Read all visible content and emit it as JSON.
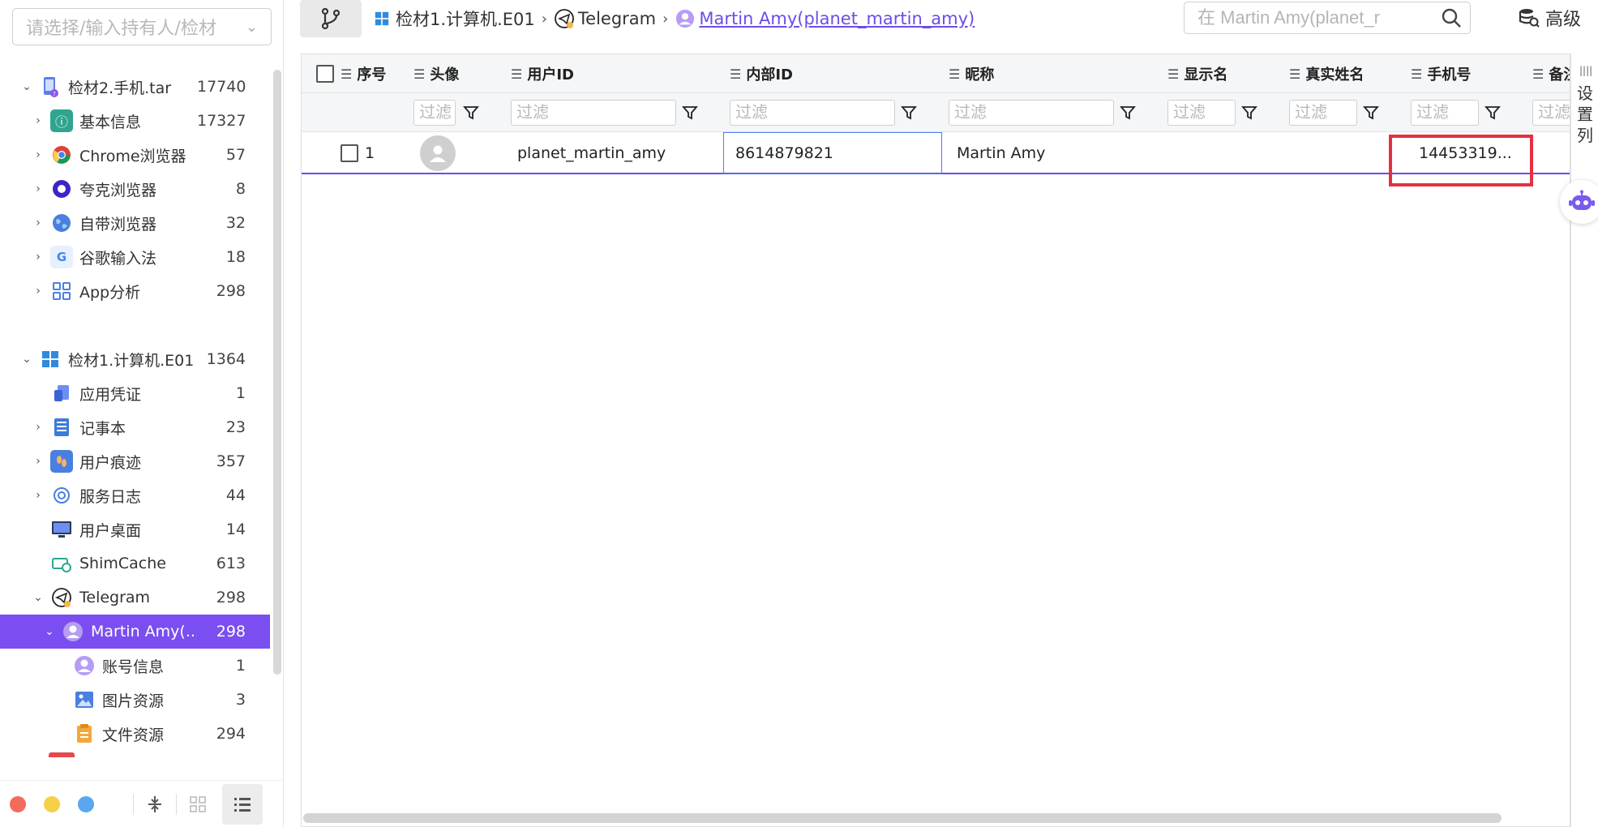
{
  "sidebar": {
    "holder_placeholder": "请选择/输入持有人/检材",
    "tree": [
      {
        "label": "检材2.手机.tar",
        "count": "17740",
        "icon": "phone-evidence-icon",
        "level": 0,
        "expanded": true
      },
      {
        "label": "基本信息",
        "count": "17327",
        "icon": "info-icon",
        "level": 1
      },
      {
        "label": "Chrome浏览器",
        "count": "57",
        "icon": "chrome-icon",
        "level": 1
      },
      {
        "label": "夸克浏览器",
        "count": "8",
        "icon": "quark-icon",
        "level": 1
      },
      {
        "label": "自带浏览器",
        "count": "32",
        "icon": "globe-icon",
        "level": 1
      },
      {
        "label": "谷歌输入法",
        "count": "18",
        "icon": "google-ime-icon",
        "level": 1
      },
      {
        "label": "App分析",
        "count": "298",
        "icon": "apps-grid-icon",
        "level": 1
      },
      {
        "label": "检材1.计算机.E01",
        "count": "1364",
        "icon": "windows-icon",
        "level": 0,
        "expanded": true
      },
      {
        "label": "应用凭证",
        "count": "1",
        "icon": "credential-icon",
        "level": 1
      },
      {
        "label": "记事本",
        "count": "23",
        "icon": "notepad-icon",
        "level": 1
      },
      {
        "label": "用户痕迹",
        "count": "357",
        "icon": "footprint-icon",
        "level": 1
      },
      {
        "label": "服务日志",
        "count": "44",
        "icon": "service-log-icon",
        "level": 1
      },
      {
        "label": "用户桌面",
        "count": "14",
        "icon": "desktop-icon",
        "level": 1
      },
      {
        "label": "ShimCache",
        "count": "613",
        "icon": "shimcache-icon",
        "level": 1
      },
      {
        "label": "Telegram",
        "count": "298",
        "icon": "telegram-icon",
        "level": 1,
        "expanded": true
      },
      {
        "label": "Martin Amy(...",
        "count": "298",
        "icon": "user-icon",
        "level": 2,
        "expanded": true,
        "active": true
      },
      {
        "label": "账号信息",
        "count": "1",
        "icon": "account-icon",
        "level": 3
      },
      {
        "label": "图片资源",
        "count": "3",
        "icon": "image-icon",
        "level": 3
      },
      {
        "label": "文件资源",
        "count": "294",
        "icon": "file-icon",
        "level": 3
      }
    ],
    "footer": {
      "dots": [
        "#f26b5b",
        "#f7d04a",
        "#5aa6f0"
      ]
    }
  },
  "topbar": {
    "crumbs": [
      "检材1.计算机.E01",
      "Telegram",
      "Martin Amy(planet_martin_amy)"
    ],
    "search_placeholder": "在 Martin Amy(planet_martin_amy) 中搜索",
    "search_value": "在 Martin Amy(planet_r",
    "advanced_label": "高级"
  },
  "grid": {
    "columns": [
      "序号",
      "头像",
      "用户ID",
      "内部ID",
      "昵称",
      "显示名",
      "真实姓名",
      "手机号",
      "备注"
    ],
    "filter_placeholder": "过滤",
    "rows": [
      {
        "index": "1",
        "user_id": "planet_martin_amy",
        "internal_id": "8614879821",
        "nickname": "Martin Amy",
        "display_name": "",
        "real_name": "",
        "phone": "14453319..."
      }
    ]
  },
  "side_panel": {
    "label": "设置列"
  },
  "colors": {
    "accent": "#7a4ef0",
    "highlight_box": "#e5313f"
  }
}
